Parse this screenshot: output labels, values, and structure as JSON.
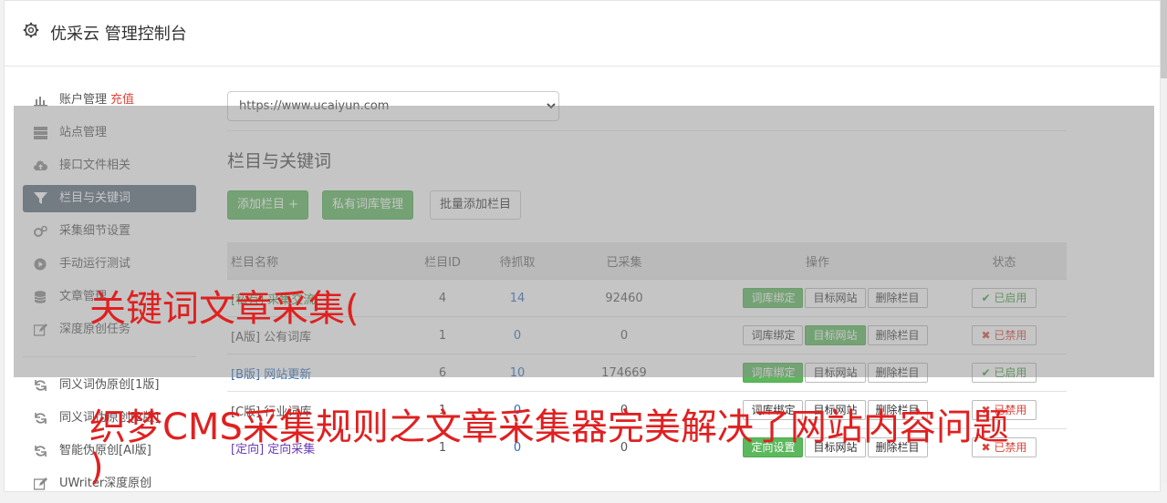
{
  "header": {
    "title": "优采云 管理控制台"
  },
  "sidebar": {
    "items": [
      {
        "label": "账户管理",
        "badge": "充值",
        "icon": "bar-chart-icon"
      },
      {
        "label": "站点管理",
        "icon": "server-icon"
      },
      {
        "label": "接口文件相关",
        "icon": "cloud-upload-icon"
      },
      {
        "label": "栏目与关键词",
        "icon": "filter-icon",
        "active": true
      },
      {
        "label": "采集细节设置",
        "icon": "gears-icon"
      },
      {
        "label": "手动运行测试",
        "icon": "play-circle-icon"
      },
      {
        "label": "文章管理",
        "icon": "database-icon"
      },
      {
        "label": "深度原创任务",
        "icon": "edit-icon"
      }
    ],
    "items2": [
      {
        "label": "同义词伪原创[1版]",
        "icon": "refresh-icon"
      },
      {
        "label": "同义词伪原创[2版]",
        "icon": "refresh-icon"
      },
      {
        "label": "智能伪原创[AI版]",
        "icon": "refresh-icon"
      },
      {
        "label": "UWriter深度原创",
        "icon": "edit-icon"
      }
    ]
  },
  "main": {
    "site_select": "https://www.ucaiyun.com",
    "section_title": "栏目与关键词",
    "buttons": {
      "add": "添加栏目 +",
      "private_lib": "私有词库管理",
      "batch_add": "批量添加栏目"
    },
    "table": {
      "headers": [
        "栏目名称",
        "栏目ID",
        "待抓取",
        "已采集",
        "操作",
        "状态"
      ],
      "rows": [
        {
          "name": "[私有] 采集交流",
          "id": "4",
          "pending": "14",
          "collected": "92460",
          "ops": [
            "词库绑定",
            "目标网站",
            "删除栏目"
          ],
          "status": "已启用"
        },
        {
          "name": "[A版] 公有词库",
          "id": "1",
          "pending": "0",
          "collected": "0",
          "ops": [
            "词库绑定",
            "目标网站",
            "删除栏目"
          ],
          "status": "已禁用"
        },
        {
          "name": "[B版] 网站更新",
          "id": "6",
          "pending": "10",
          "collected": "174669",
          "ops": [
            "词库绑定",
            "目标网站",
            "删除栏目"
          ],
          "status": "已启用"
        },
        {
          "name": "[C版] 行业词库",
          "id": "1",
          "pending": "0",
          "collected": "0",
          "ops": [
            "词库绑定",
            "目标网站",
            "删除栏目"
          ],
          "status": "已禁用"
        },
        {
          "name": "[定向] 定向采集",
          "id": "1",
          "pending": "0",
          "collected": "0",
          "ops": [
            "定向设置",
            "目标网站",
            "删除栏目"
          ],
          "status": "已禁用"
        }
      ]
    }
  },
  "overlay": {
    "line1": "关键词文章采集(",
    "line2": "织梦CMS采集规则之文章采集器完美解决了网站内容问题",
    "line3": ")"
  },
  "colors": {
    "accent": "#5cb85c",
    "active_nav": "#5a6a7a",
    "overlay_text": "#e02020"
  }
}
